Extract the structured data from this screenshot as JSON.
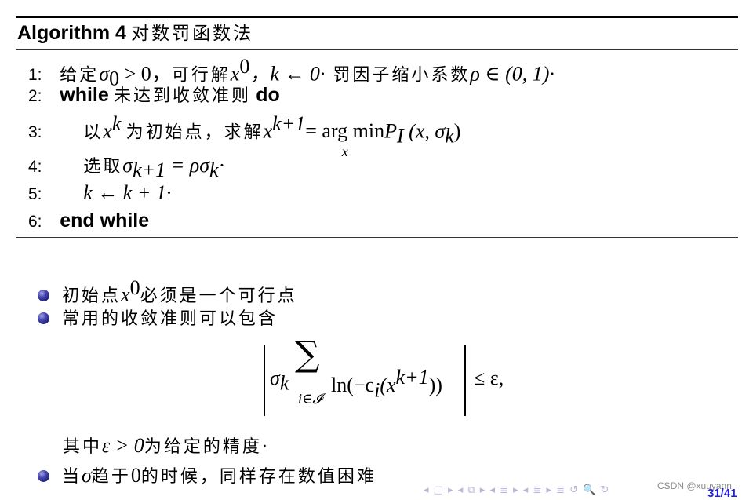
{
  "algorithm": {
    "keyword": "Algorithm 4",
    "title": "对数罚函数法",
    "lines": [
      {
        "num": "1:",
        "text_a": "给定",
        "math_a": "σ",
        "sub_a": "0",
        "math_b": " > 0，",
        "text_b": "可行解",
        "math_c": "x",
        "sup_c": "0",
        "math_d": "，k ← 0·",
        "text_c": " 罚因子缩小系数",
        "math_e": "ρ ∈ (0, 1)·"
      },
      {
        "num": "2:",
        "kw_a": "while",
        "text": "未达到收敛准则",
        "kw_b": "do"
      },
      {
        "num": "3:",
        "text_a": "以",
        "math_a": "x",
        "sup_a": "k",
        "text_b": "为初始点，求解",
        "math_b": "x",
        "sup_b": "k+1",
        "math_c": " = arg min",
        "under": "x",
        "math_d": "P",
        "sub_d": "I",
        "math_e": " (x, σ",
        "sub_e": "k",
        "math_f": ")"
      },
      {
        "num": "4:",
        "text_a": "选取",
        "math_a": "σ",
        "sub_a": "k+1",
        "math_b": " = ρσ",
        "sub_b": "k",
        "math_c": "·"
      },
      {
        "num": "5:",
        "math": "k ← k + 1·"
      },
      {
        "num": "6:",
        "kw": "end while"
      }
    ]
  },
  "bullets": [
    {
      "text_a": "初始点",
      "math": "x",
      "sup": "0",
      "text_b": "必须是一个可行点"
    },
    {
      "text": "常用的收敛准则可以包含"
    }
  ],
  "formula": {
    "sigma": "σ",
    "sigma_sub": "k",
    "sum": "∑",
    "sum_index": "i∈𝓘",
    "expr": "ln(−c",
    "expr_sub": "i",
    "expr_b": "(x",
    "expr_sup": "k+1",
    "expr_c": "))",
    "rhs": "≤ ε,"
  },
  "precision_note": {
    "text_a": "其中",
    "math": "ε > 0",
    "text_b": "为给定的精度·"
  },
  "bullet3": {
    "text_a": "当",
    "math": "σ",
    "text_b": "趋于",
    "math_b": "0",
    "text_c": "的时候，同样存在数值困难"
  },
  "footer": {
    "nav_symbols": "◂ □ ▸ ◂ ⧉ ▸ ◂ ≣ ▸ ◂ ≣ ▸   ≣   ↺ 🔍 ↻",
    "watermark": "CSDN @xuuyann",
    "page": "31/41",
    "page_color": "#1e1ee6"
  }
}
